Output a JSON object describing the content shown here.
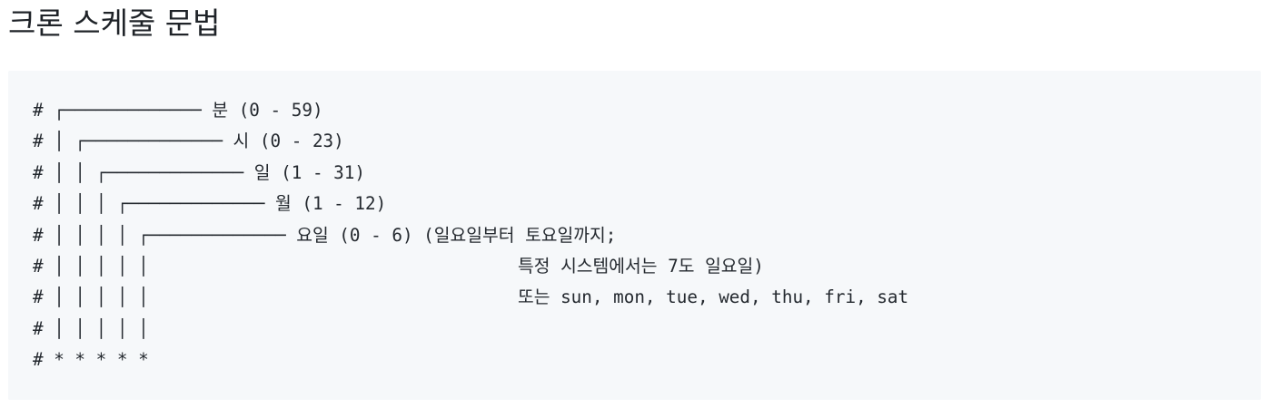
{
  "heading": "크론 스케줄 문법",
  "code_lines": [
    "# ┌───────────── 분 (0 - 59)",
    "# │ ┌───────────── 시 (0 - 23)",
    "# │ │ ┌───────────── 일 (1 - 31)",
    "# │ │ │ ┌───────────── 월 (1 - 12)",
    "# │ │ │ │ ┌───────────── 요일 (0 - 6) (일요일부터 토요일까지;",
    "# │ │ │ │ │                                   특정 시스템에서는 7도 일요일)",
    "# │ │ │ │ │                                   또는 sun, mon, tue, wed, thu, fri, sat",
    "# │ │ │ │ │",
    "# * * * * *"
  ]
}
